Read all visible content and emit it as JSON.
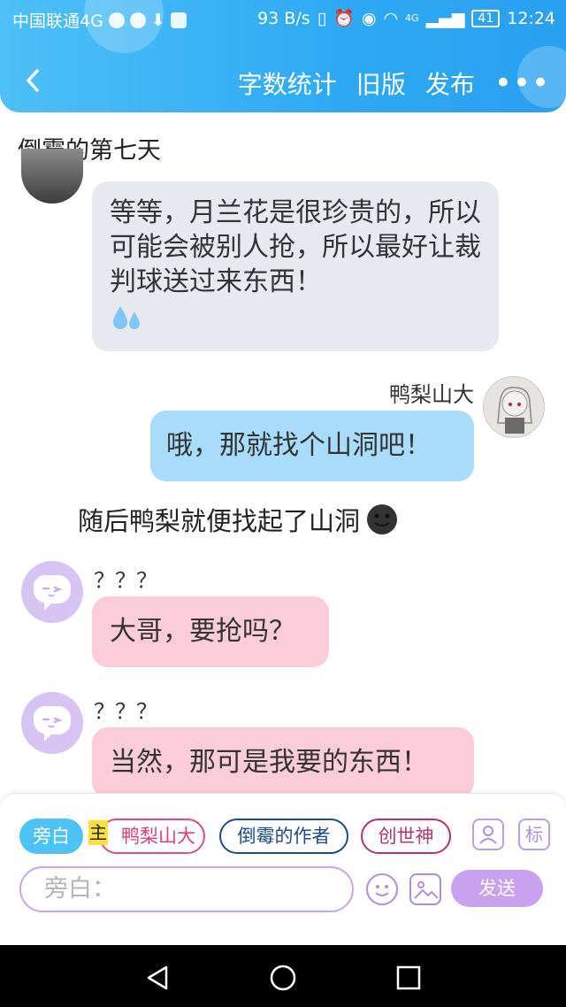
{
  "status_bar": {
    "carrier": "中国联通4G",
    "speed": "93 B/s",
    "network": "4G",
    "battery": "41",
    "time": "12:24"
  },
  "nav": {
    "word_count": "字数统计",
    "old_version": "旧版",
    "publish": "发布"
  },
  "chapter_title": "倒霉的第七天",
  "messages": [
    {
      "text": "等等，月兰花是很珍贵的，所以可能会被别人抢，所以最好让裁判球送过来东西！"
    },
    {
      "speaker": "鸭梨山大",
      "text": "哦，那就找个山洞吧！"
    },
    {
      "narration": "随后鸭梨就便找起了山洞"
    },
    {
      "speaker": "？？？",
      "text": "大哥，要抢吗？"
    },
    {
      "speaker": "？？？",
      "text": "当然，那可是我要的东西！"
    }
  ],
  "roles": {
    "aside": "旁白",
    "master_tag": "主",
    "role1": "鸭梨山大",
    "role2": "倒霉的作者",
    "role3": "创世神",
    "mark_icon_text": "标"
  },
  "composer": {
    "placeholder": "旁白：",
    "send": "发送"
  },
  "colors": {
    "header": "#2ea9f4",
    "accent_purple": "#c9a1ef",
    "bubble_blue": "#a9dcfb",
    "bubble_pink": "#fbcdd8",
    "bubble_gray": "#e6e9f0"
  }
}
